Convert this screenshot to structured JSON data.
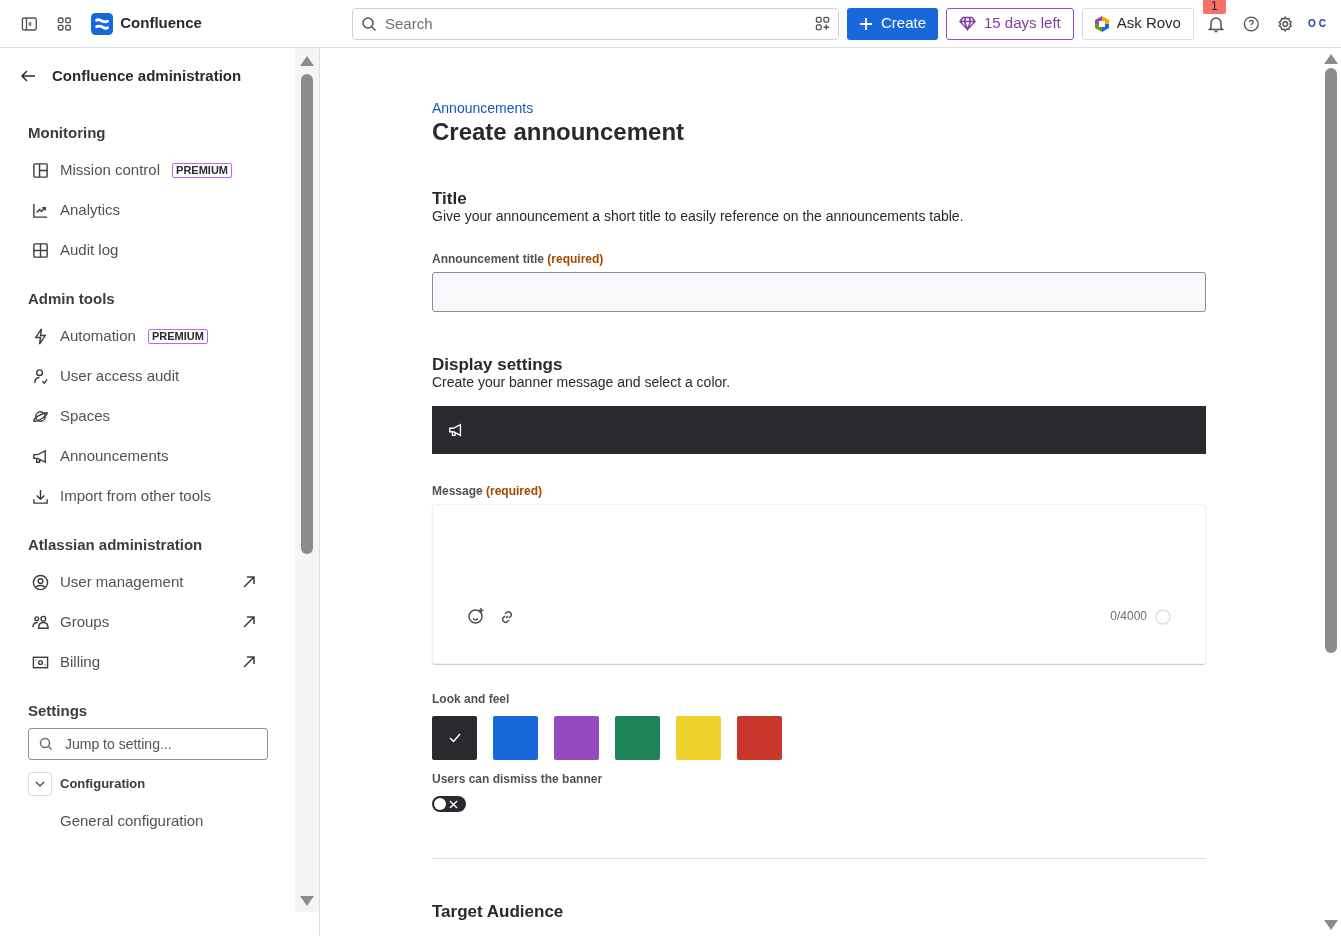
{
  "topbar": {
    "product": "Confluence",
    "search_placeholder": "Search",
    "create": "Create",
    "trial": "15 days left",
    "ask": "Ask Rovo",
    "notifications": "1",
    "avatar": "OC"
  },
  "sidebar": {
    "back_title": "Confluence administration",
    "sections": [
      {
        "title": "Monitoring",
        "items": [
          {
            "kind": "panels",
            "label": "Mission control",
            "badge": "PREMIUM"
          },
          {
            "kind": "chart",
            "label": "Analytics"
          },
          {
            "kind": "grid",
            "label": "Audit log"
          }
        ]
      },
      {
        "title": "Admin tools",
        "items": [
          {
            "kind": "bolt",
            "label": "Automation",
            "badge": "PREMIUM"
          },
          {
            "kind": "usercheck",
            "label": "User access audit"
          },
          {
            "kind": "planet",
            "label": "Spaces"
          },
          {
            "kind": "megaphone",
            "label": "Announcements"
          },
          {
            "kind": "download",
            "label": "Import from other tools"
          }
        ]
      },
      {
        "title": "Atlassian administration",
        "items": [
          {
            "kind": "usercircle",
            "label": "User management",
            "external": true
          },
          {
            "kind": "people",
            "label": "Groups",
            "external": true
          },
          {
            "kind": "money",
            "label": "Billing",
            "external": true
          }
        ]
      }
    ],
    "settings_title": "Settings",
    "jump_placeholder": "Jump to setting...",
    "group": {
      "label": "Configuration",
      "expanded": true,
      "children": [
        "General configuration"
      ]
    }
  },
  "main": {
    "breadcrumb": "Announcements",
    "heading": "Create announcement",
    "title_section": {
      "title": "Title",
      "description": "Give your announcement a short title to easily reference on the announcements table.",
      "field_label": "Announcement title",
      "required": "(required)"
    },
    "display_section": {
      "title": "Display settings",
      "description": "Create your banner message and select a color.",
      "message_label": "Message",
      "required": "(required)",
      "counter": "0/4000",
      "look_label": "Look and feel",
      "swatches": [
        {
          "color": "#292a2e",
          "selected": true
        },
        {
          "color": "#1868db",
          "selected": false
        },
        {
          "color": "#964ac0",
          "selected": false
        },
        {
          "color": "#1f845a",
          "selected": false
        },
        {
          "color": "#eed12b",
          "selected": false
        },
        {
          "color": "#c9372c",
          "selected": false
        }
      ],
      "dismiss_label": "Users can dismiss the banner",
      "dismiss_on": false
    },
    "target_title": "Target Audience"
  }
}
